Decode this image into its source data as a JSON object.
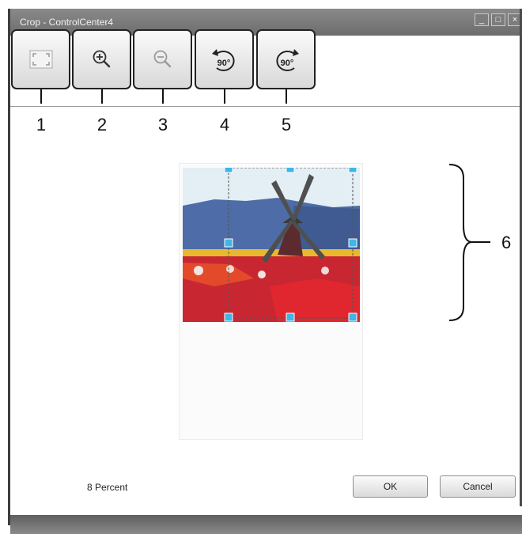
{
  "window": {
    "title": "Crop - ControlCenter4",
    "minimize_glyph": "_",
    "maximize_glyph": "□",
    "close_glyph": "×"
  },
  "toolbar": {
    "buttons": [
      {
        "icon": "fit-to-window-icon",
        "label": ""
      },
      {
        "icon": "zoom-in-icon",
        "label": ""
      },
      {
        "icon": "zoom-out-icon",
        "label": ""
      },
      {
        "icon": "rotate-left-icon",
        "label": "90°"
      },
      {
        "icon": "rotate-right-icon",
        "label": "90°"
      }
    ]
  },
  "callouts": [
    "1",
    "2",
    "3",
    "4",
    "5",
    "6"
  ],
  "status": {
    "zoom_text": "8 Percent"
  },
  "dialog": {
    "ok_label": "OK",
    "cancel_label": "Cancel"
  },
  "colors": {
    "titlebar": "#777777",
    "handle": "#3fb6e8",
    "button_border": "#222222"
  }
}
